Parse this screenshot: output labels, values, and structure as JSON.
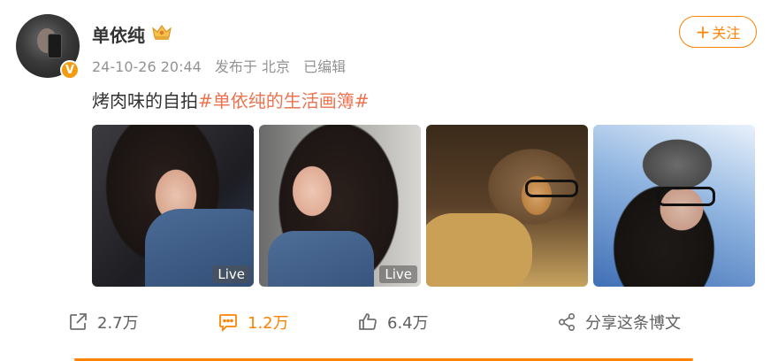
{
  "author": {
    "name": "单依纯",
    "verified_badge": "V"
  },
  "meta": {
    "datetime": "24-10-26 20:44",
    "location": "发布于 北京",
    "edited": "已编辑"
  },
  "follow_button": {
    "plus": "+",
    "label": "关注"
  },
  "post": {
    "text": "烤肉味的自拍",
    "hashtag": "#单依纯的生活画簿#"
  },
  "photos": [
    {
      "live_label": "Live"
    },
    {
      "live_label": "Live"
    },
    {
      "live_label": ""
    },
    {
      "live_label": ""
    }
  ],
  "actions": {
    "share": "2.7万",
    "comments": "1.2万",
    "likes": "6.4万",
    "share_blog": "分享这条博文"
  },
  "colors": {
    "accent": "#ff8200",
    "hashtag": "#eb7350",
    "meta": "#939393"
  }
}
